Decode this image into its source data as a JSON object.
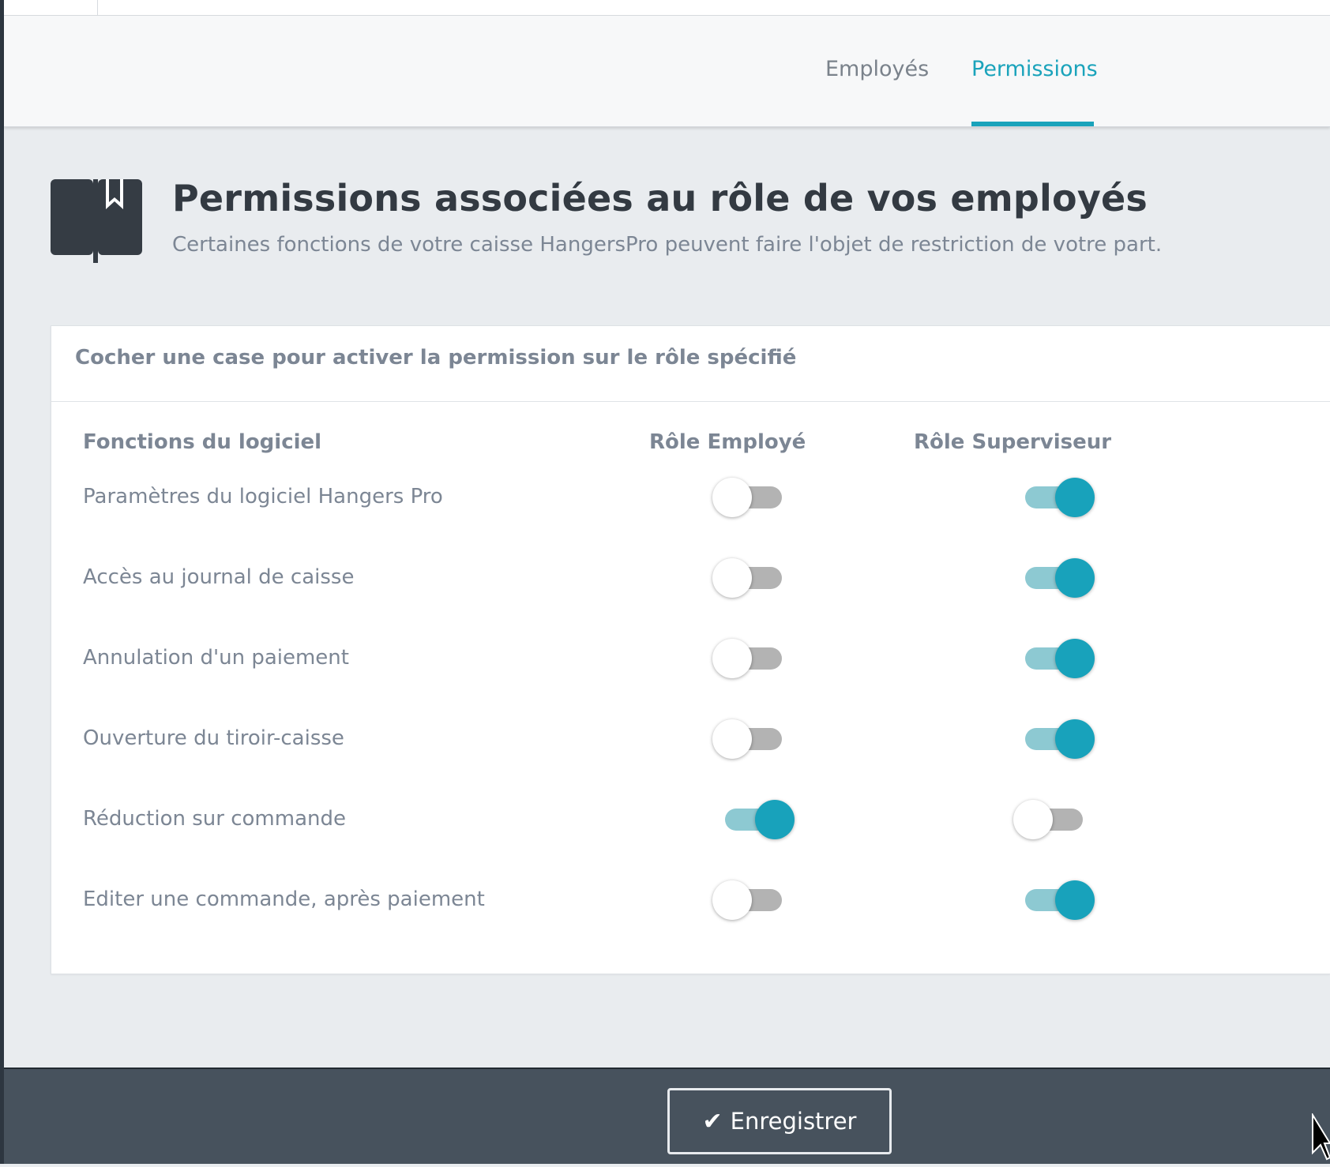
{
  "tabs": [
    {
      "label": "Employés",
      "active": false
    },
    {
      "label": "Permissions",
      "active": true
    }
  ],
  "header": {
    "icon": "book-bookmark-icon",
    "title": "Permissions associées au rôle de vos employés",
    "subtitle": "Certaines fonctions de votre caisse HangersPro peuvent faire l'objet de restriction de votre part."
  },
  "card": {
    "instruction": "Cocher une case pour activer la permission sur le rôle spécifié",
    "columns": [
      "Fonctions du logiciel",
      "Rôle Employé",
      "Rôle Superviseur"
    ],
    "rows": [
      {
        "label": "Paramètres du logiciel Hangers Pro",
        "employe": false,
        "superviseur": true
      },
      {
        "label": "Accès au journal de caisse",
        "employe": false,
        "superviseur": true
      },
      {
        "label": "Annulation d'un paiement",
        "employe": false,
        "superviseur": true
      },
      {
        "label": "Ouverture du tiroir-caisse",
        "employe": false,
        "superviseur": true
      },
      {
        "label": "Réduction sur commande",
        "employe": true,
        "superviseur": false
      },
      {
        "label": "Editer une commande, après paiement",
        "employe": false,
        "superviseur": true
      }
    ]
  },
  "footer": {
    "save_label": "Enregistrer",
    "save_icon": "check-icon"
  },
  "colors": {
    "accent": "#1aa3bb",
    "footer_bg": "#47525d",
    "toggle_off": "#b3b3b3",
    "toggle_on_track": "#8dc9d2"
  }
}
